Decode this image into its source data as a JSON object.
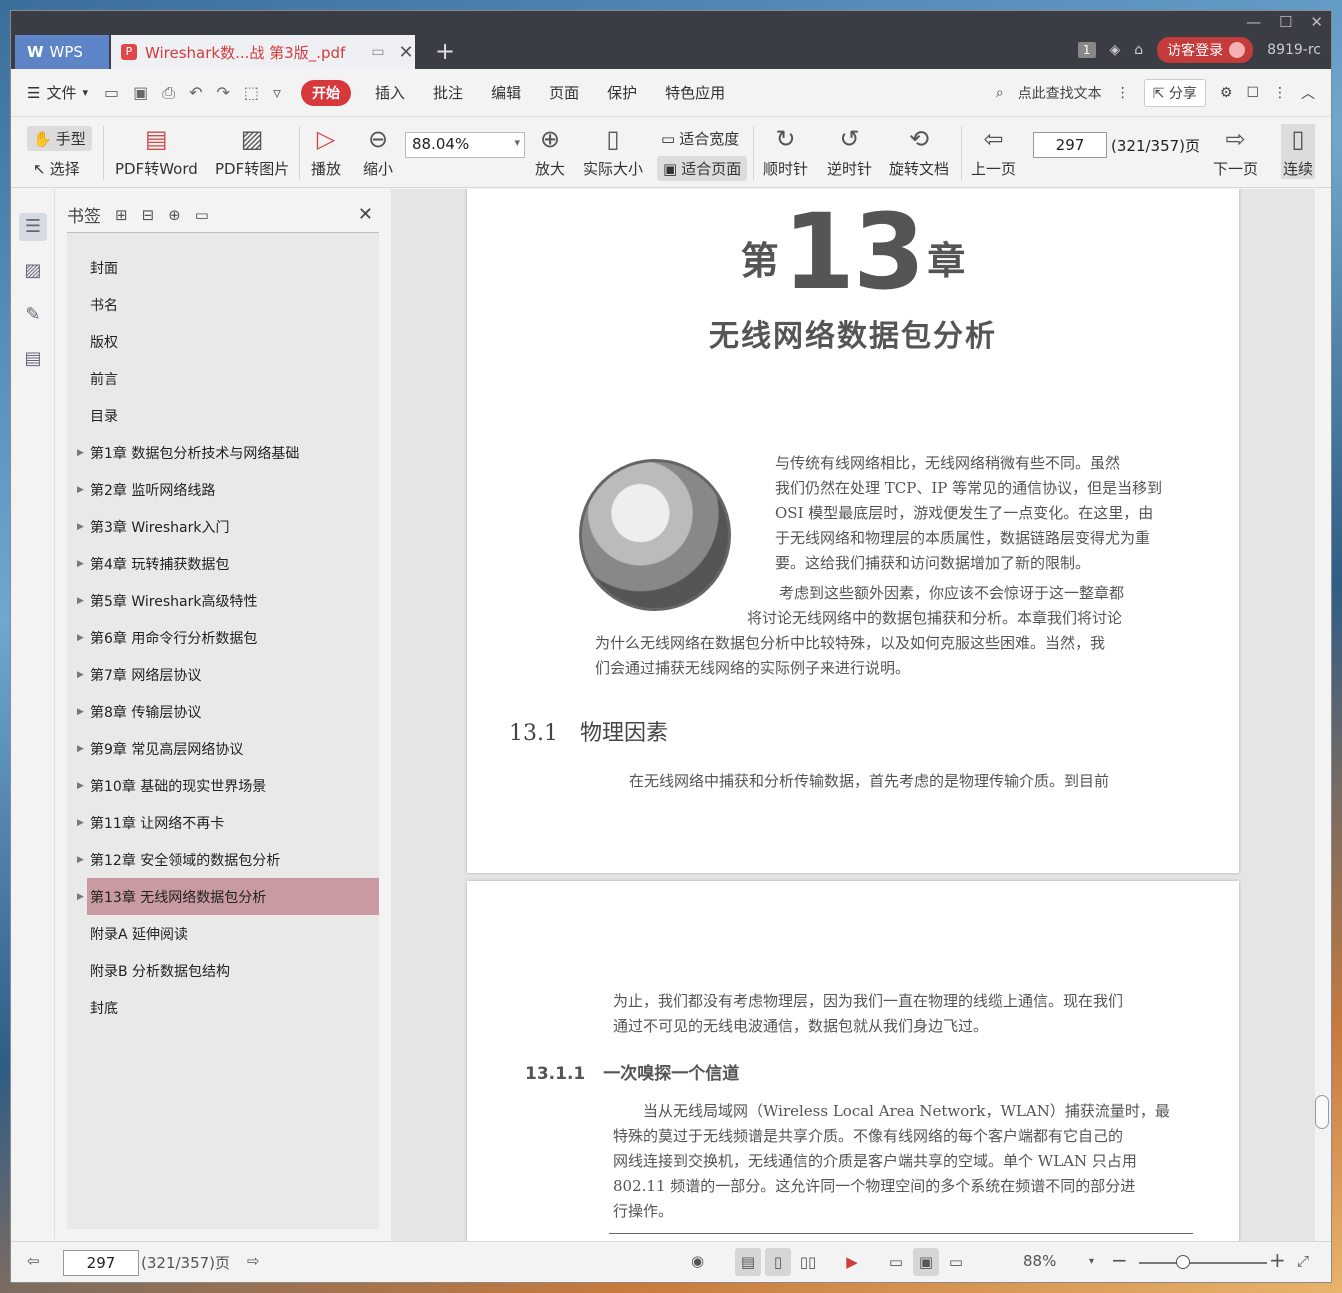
{
  "tabbar": {
    "app_label": "WPS",
    "doc_tab_title": "Wireshark数...战 第3版_.pdf",
    "page_badge": "1",
    "login_label": "访客登录",
    "user_label": "8919-rc"
  },
  "menu": {
    "file_label": "文件",
    "items": [
      "开始",
      "插入",
      "批注",
      "编辑",
      "页面",
      "保护",
      "特色应用"
    ],
    "search_label": "点此查找文本",
    "share_label": "分享"
  },
  "ribbon": {
    "hand_label": "手型",
    "select_label": "选择",
    "pdf_to_word": "PDF转Word",
    "pdf_to_image": "PDF转图片",
    "play": "播放",
    "zoom_out": "缩小",
    "zoom_value": "88.04%",
    "zoom_in": "放大",
    "actual_size": "实际大小",
    "fit_width": "适合宽度",
    "fit_page": "适合页面",
    "rotate_cw": "顺时针",
    "rotate_ccw": "逆时针",
    "rotate_doc": "旋转文档",
    "prev_page": "上一页",
    "page_value": "297",
    "page_total": "(321/357)页",
    "next_page": "下一页",
    "continuous": "连续"
  },
  "bookmarks": {
    "title": "书签",
    "items": [
      {
        "label": "封面",
        "expandable": false
      },
      {
        "label": "书名",
        "expandable": false
      },
      {
        "label": "版权",
        "expandable": false
      },
      {
        "label": "前言",
        "expandable": false
      },
      {
        "label": "目录",
        "expandable": false
      },
      {
        "label": "第1章 数据包分析技术与网络基础",
        "expandable": true
      },
      {
        "label": "第2章 监听网络线路",
        "expandable": true
      },
      {
        "label": "第3章 Wireshark入门",
        "expandable": true
      },
      {
        "label": "第4章 玩转捕获数据包",
        "expandable": true
      },
      {
        "label": "第5章 Wireshark高级特性",
        "expandable": true
      },
      {
        "label": "第6章 用命令行分析数据包",
        "expandable": true
      },
      {
        "label": "第7章 网络层协议",
        "expandable": true
      },
      {
        "label": "第8章 传输层协议",
        "expandable": true
      },
      {
        "label": "第9章 常见高层网络协议",
        "expandable": true
      },
      {
        "label": "第10章 基础的现实世界场景",
        "expandable": true
      },
      {
        "label": "第11章 让网络不再卡",
        "expandable": true
      },
      {
        "label": "第12章 安全领域的数据包分析",
        "expandable": true
      },
      {
        "label": "第13章 无线网络数据包分析",
        "expandable": true,
        "selected": true
      },
      {
        "label": "附录A 延伸阅读",
        "expandable": false
      },
      {
        "label": "附录B 分析数据包结构",
        "expandable": false
      },
      {
        "label": "封底",
        "expandable": false
      }
    ]
  },
  "page1": {
    "chapter_prefix": "第",
    "chapter_number": "13",
    "chapter_suffix": "章",
    "chapter_title": "无线网络数据包分析",
    "intro_lines": [
      "与传统有线网络相比，无线网络稍微有些不同。虽然",
      "我们仍然在处理 TCP、IP 等常见的通信协议，但是当移到",
      "OSI 模型最底层时，游戏便发生了一点变化。在这里，由",
      "于无线网络和物理层的本质属性，数据链路层变得尤为重",
      "要。这给我们捕获和访问数据增加了新的限制。"
    ],
    "para2_lines": [
      "考虑到这些额外因素，你应该不会惊讶于这一整章都",
      "将讨论无线网络中的数据包捕获和分析。本章我们将讨论",
      "为什么无线网络在数据包分析中比较特殊，以及如何克服这些困难。当然，我",
      "们会通过捕获无线网络的实际例子来进行说明。"
    ],
    "section_number": "13.1",
    "section_title": "物理因素",
    "section_line": "在无线网络中捕获和分析传输数据，首先考虑的是物理传输介质。到目前"
  },
  "page2": {
    "cont_lines": [
      "为止，我们都没有考虑物理层，因为我们一直在物理的线缆上通信。现在我们",
      "通过不可见的无线电波通信，数据包就从我们身边飞过。"
    ],
    "subsection_number": "13.1.1",
    "subsection_title": "一次嗅探一个信道",
    "body_lines": [
      "当从无线局域网（Wireless Local Area Network，WLAN）捕获流量时，最",
      "特殊的莫过于无线频谱是共享介质。不像有线网络的每个客户端都有它自己的",
      "网线连接到交换机，无线通信的介质是客户端共享的空域。单个 WLAN 只占用",
      "802.11 频谱的一部分。这允许同一个物理空间的多个系统在频谱不同的部分进",
      "行操作。"
    ]
  },
  "statusbar": {
    "page_value": "297",
    "page_total": "(321/357)页",
    "zoom_label": "88%",
    "zoom_level": 0.34
  }
}
